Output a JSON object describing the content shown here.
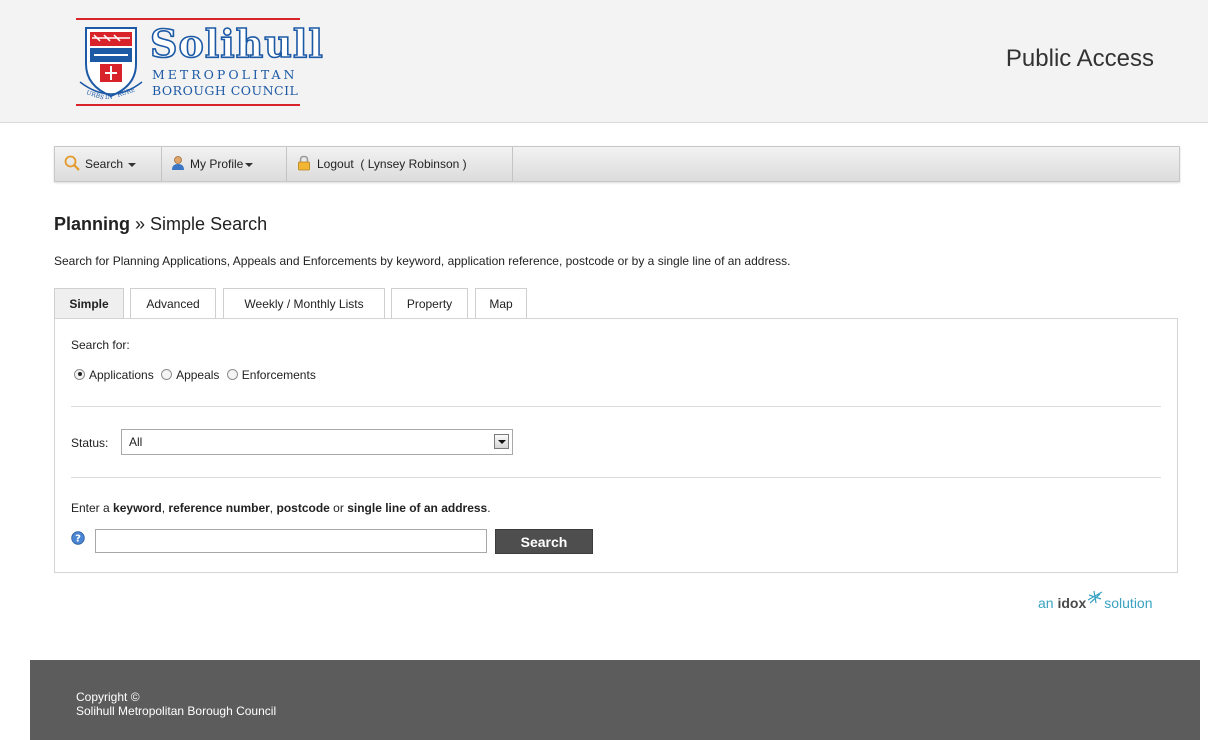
{
  "header": {
    "logo": {
      "word": "Solihull",
      "line1": "METROPOLITAN",
      "line2": "BOROUGH COUNCIL",
      "motto": "URBS IN RURE"
    },
    "site_title": "Public Access"
  },
  "nav": {
    "search_label": "Search",
    "profile_label": "My Profile",
    "logout_label": "Logout",
    "user_label": "( Lynsey Robinson )"
  },
  "page": {
    "heading_bold": "Planning",
    "heading_sep": "»",
    "heading_rest": "Simple Search",
    "description": "Search for Planning Applications, Appeals and Enforcements by keyword, application reference, postcode or by a single line of an address."
  },
  "tabs": [
    {
      "label": "Simple",
      "active": true
    },
    {
      "label": "Advanced",
      "active": false
    },
    {
      "label": "Weekly / Monthly Lists",
      "active": false
    },
    {
      "label": "Property",
      "active": false
    },
    {
      "label": "Map",
      "active": false
    }
  ],
  "form": {
    "search_for_label": "Search for:",
    "radios": [
      {
        "label": "Applications",
        "checked": true
      },
      {
        "label": "Appeals",
        "checked": false
      },
      {
        "label": "Enforcements",
        "checked": false
      }
    ],
    "status_label": "Status:",
    "status_value": "All",
    "enter_prefix": "Enter a",
    "enter_keyword": "keyword",
    "enter_sep1": ",",
    "enter_reference": "reference number",
    "enter_sep2": ",",
    "enter_postcode": "postcode",
    "enter_or": "or",
    "enter_address": "single line of an address",
    "enter_end": ".",
    "search_input_value": "",
    "search_button": "Search"
  },
  "branding": {
    "an": "an",
    "idox": "idox",
    "solution": "solution"
  },
  "footer": {
    "line1": "Copyright ©",
    "line2": "Solihull Metropolitan Borough Council"
  },
  "colors": {
    "brand_blue": "#1d5aa6",
    "brand_red": "#d8232a",
    "footer_bg": "#5c5c5c",
    "button_bg": "#4e4e4e",
    "idox_teal": "#3aa3c2"
  }
}
